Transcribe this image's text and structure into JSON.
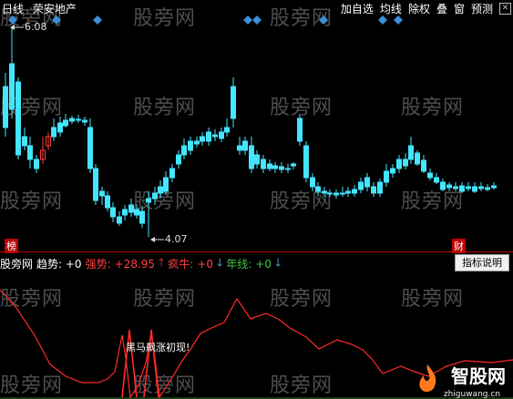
{
  "toolbar": {
    "period": "日线",
    "stock_name": "荣安地产",
    "buttons": [
      "加自选",
      "均线",
      "除权",
      "叠",
      "窗",
      "预测"
    ]
  },
  "watermark": "股旁网",
  "price_labels": {
    "max": "6.08",
    "min": "4.07"
  },
  "tags": {
    "left": "榜",
    "right": "财"
  },
  "indicator_bar": {
    "source": "股旁网",
    "trend": "趋势: +0",
    "strong_label": "强势:",
    "strong_value": "+28.95",
    "crazy_label": "疯牛:",
    "crazy_value": "+0",
    "year_label": "年线:",
    "year_value": "+0"
  },
  "indicator_button": "指标说明",
  "signal_text": "黑马飙涨初现!",
  "logo": {
    "text": "智股网",
    "url": "zhiguwang.cn"
  },
  "colors": {
    "up": "#ff3b3b",
    "down": "#44e5ff",
    "bg": "#000000",
    "accent": "#3a8fd6"
  }
}
